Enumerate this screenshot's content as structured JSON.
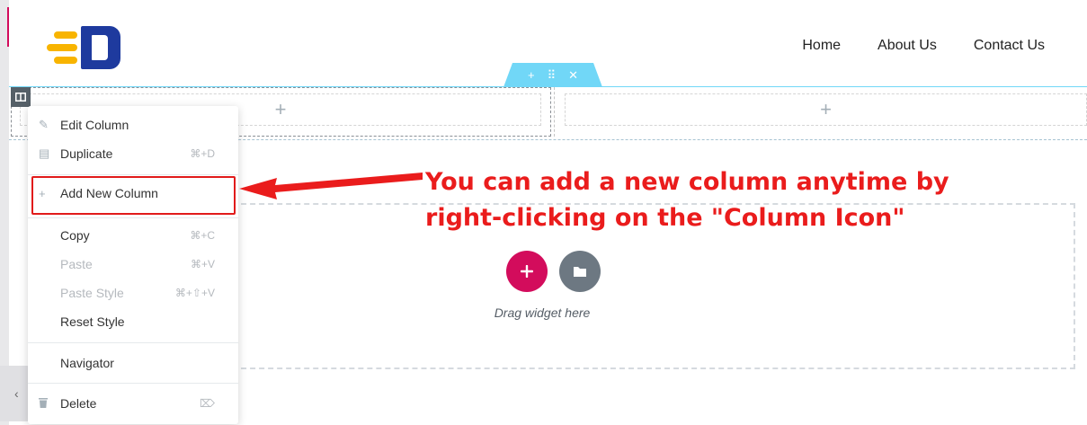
{
  "nav": {
    "items": [
      {
        "label": "Home"
      },
      {
        "label": "About Us"
      },
      {
        "label": "Contact Us"
      }
    ]
  },
  "section_handle": {
    "icons": [
      "plus-icon",
      "drag-handle-icon",
      "close-icon"
    ],
    "glyphs": [
      "+",
      "⠿",
      "✕"
    ]
  },
  "columns": {
    "add_glyph": "+"
  },
  "drop_area": {
    "drag_text": "Drag widget here"
  },
  "context_menu": {
    "items": [
      {
        "label": "Edit Column",
        "shortcut": "",
        "icon": "pencil-icon",
        "glyph": "✎",
        "enabled": true
      },
      {
        "label": "Duplicate",
        "shortcut": "⌘+D",
        "icon": "duplicate-icon",
        "glyph": "▤",
        "enabled": true
      },
      {
        "label": "Add New Column",
        "shortcut": "",
        "icon": "plus-icon",
        "glyph": "+",
        "enabled": true
      },
      {
        "label": "Copy",
        "shortcut": "⌘+C",
        "enabled": true
      },
      {
        "label": "Paste",
        "shortcut": "⌘+V",
        "enabled": false
      },
      {
        "label": "Paste Style",
        "shortcut": "⌘+⇧+V",
        "enabled": false
      },
      {
        "label": "Reset Style",
        "shortcut": "",
        "enabled": true
      },
      {
        "label": "Navigator",
        "shortcut": "",
        "enabled": true
      },
      {
        "label": "Delete",
        "shortcut": "⌦",
        "icon": "trash-icon",
        "glyph": "🗑",
        "enabled": true
      }
    ]
  },
  "annotation": {
    "line1": "You can add a new column anytime by",
    "line2": "right-clicking on the \"Column Icon\""
  },
  "colors": {
    "accent_pink": "#d30c5c",
    "handle_blue": "#71d7f7",
    "annotation_red": "#ea1c1c",
    "logo_yellow": "#f8b400",
    "logo_blue": "#1e3a9e"
  }
}
